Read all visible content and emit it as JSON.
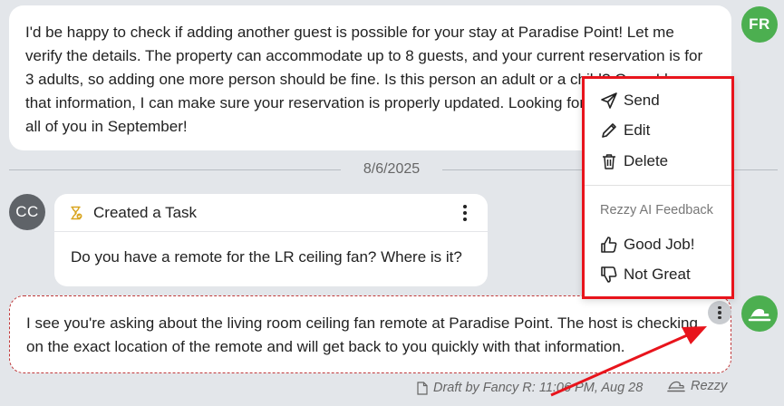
{
  "messages": {
    "guest_reply": {
      "text": "I'd be happy to check if adding another guest is possible for your stay at Paradise Point! Let me verify the details. The property can accommodate up to 8 guests, and your current reservation is for 3 adults, so adding one more person should be fine. Is this person an adult or a child? Once I have that information, I can make sure your reservation is properly updated. Looking forward to welcoming all of you in September!",
      "avatar": "FR"
    },
    "date_divider": "8/6/2025",
    "task": {
      "avatar": "CC",
      "title": "Created a Task",
      "body": "Do you have a remote for the LR ceiling fan? Where is it?"
    },
    "draft": {
      "text": "I see you're asking about the living room ceiling fan remote at Paradise Point. The host is checking on the exact location of the remote and will get back to you quickly with that information.",
      "meta": "Draft by Fancy R: 11:06 PM, Aug 28",
      "assistant": "Rezzy"
    }
  },
  "menu": {
    "send": "Send",
    "edit": "Edit",
    "delete": "Delete",
    "section_label": "Rezzy AI Feedback",
    "good": "Good Job!",
    "bad": "Not Great"
  },
  "colors": {
    "accent_green": "#4caf50",
    "highlight_red": "#e8141c",
    "draft_border": "#c0393b"
  },
  "icons": [
    "send-icon",
    "pencil-icon",
    "trash-icon",
    "thumbs-up-icon",
    "thumbs-down-icon",
    "hourglass-icon",
    "document-icon",
    "rezzy-logo-icon",
    "kebab-icon"
  ]
}
